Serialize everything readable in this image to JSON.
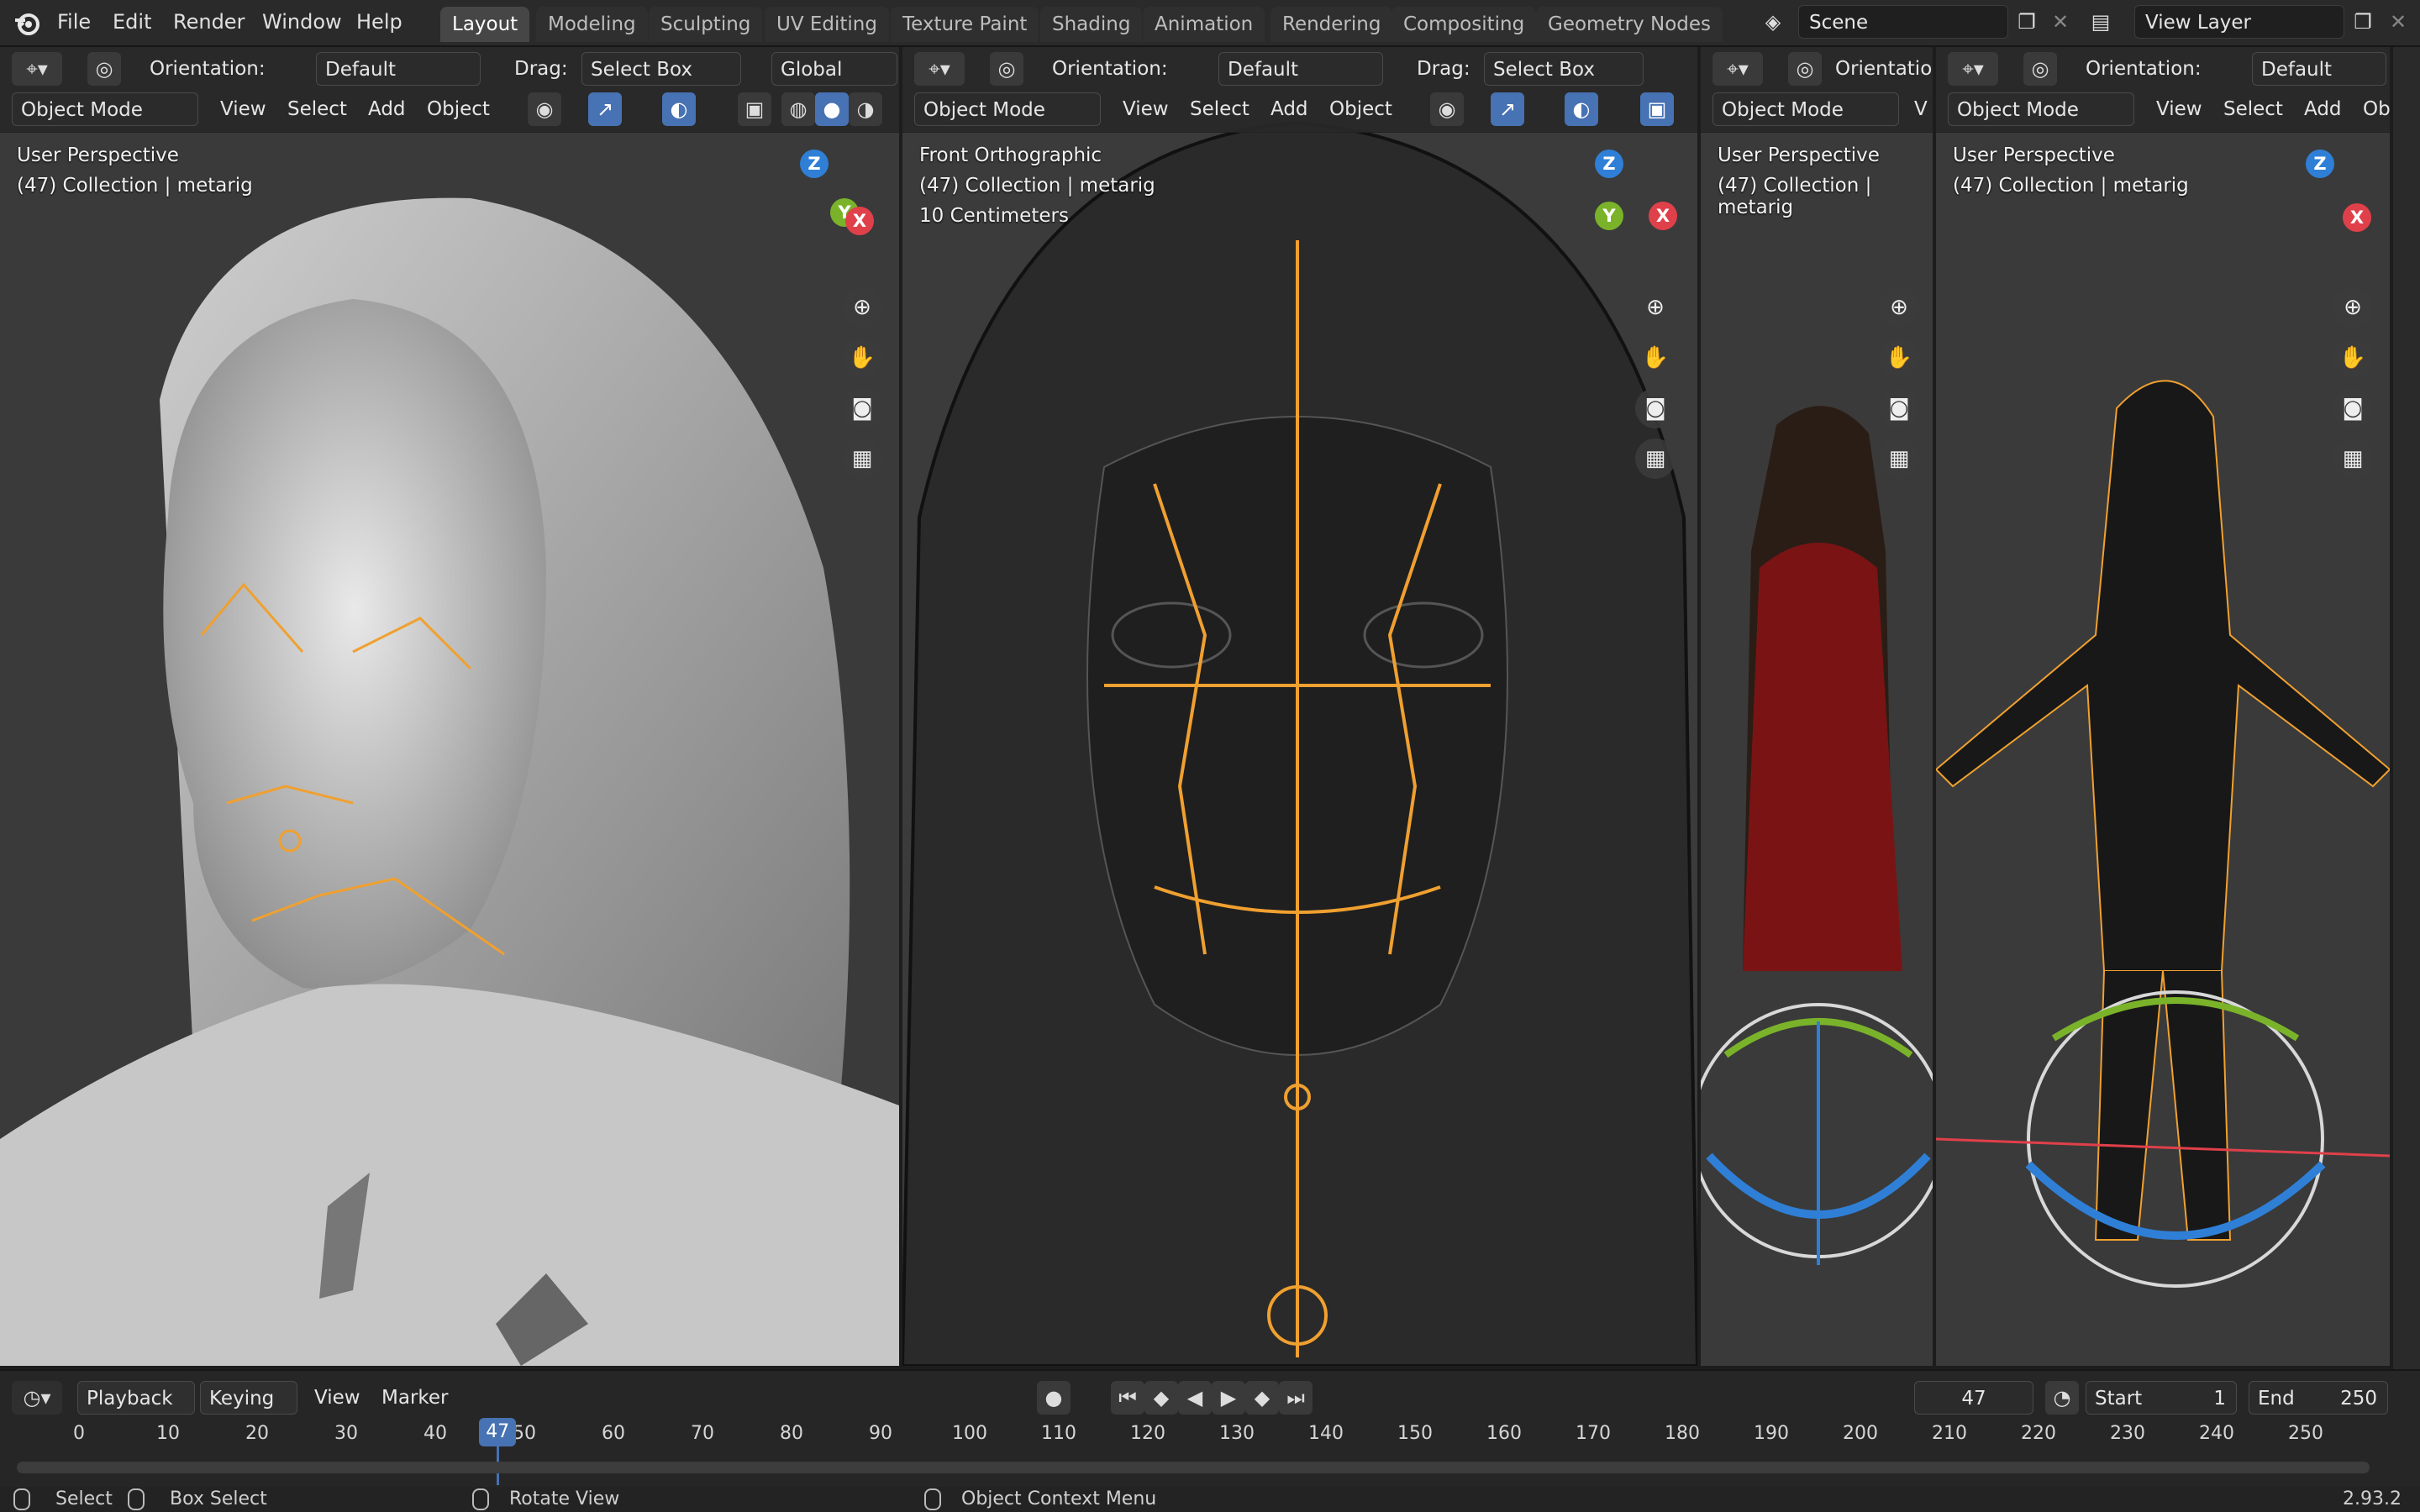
{
  "menu": [
    "File",
    "Edit",
    "Render",
    "Window",
    "Help"
  ],
  "workspaces": [
    "Layout",
    "Modeling",
    "Sculpting",
    "UV Editing",
    "Texture Paint",
    "Shading",
    "Animation",
    "Rendering",
    "Compositing",
    "Geometry Nodes"
  ],
  "scene": {
    "name": "Scene",
    "view_layer": "View Layer"
  },
  "viewports": [
    {
      "orientation_label": "Orientation:",
      "orientation": "Default",
      "drag_label": "Drag:",
      "drag": "Select Box",
      "transform": "Global",
      "mode": "Object Mode",
      "menus": [
        "View",
        "Select",
        "Add",
        "Object"
      ],
      "view_name": "User Perspective",
      "collection": "(47) Collection | metarig",
      "scale": ""
    },
    {
      "orientation_label": "Orientation:",
      "orientation": "Default",
      "drag_label": "Drag:",
      "drag": "Select Box",
      "mode": "Object Mode",
      "menus": [
        "View",
        "Select",
        "Add",
        "Object"
      ],
      "view_name": "Front Orthographic",
      "collection": "(47) Collection | metarig",
      "scale": "10 Centimeters"
    },
    {
      "orientation_label": "Orientation:",
      "mode": "Object Mode",
      "menus": [
        "V"
      ],
      "view_name": "User Perspective",
      "collection": "(47) Collection | metarig"
    },
    {
      "orientation_label": "Orientation:",
      "orientation": "Default",
      "mode": "Object Mode",
      "menus": [
        "View",
        "Select",
        "Add",
        "Ob"
      ],
      "view_name": "User Perspective",
      "collection": "(47) Collection | metarig"
    }
  ],
  "gizmo": {
    "z": "Z",
    "y": "Y",
    "x": "X"
  },
  "timeline": {
    "menus": [
      "Playback",
      "Keying",
      "View",
      "Marker"
    ],
    "current_frame": "47",
    "start_label": "Start",
    "start": "1",
    "end_label": "End",
    "end": "250",
    "ticks": [
      "0",
      "10",
      "20",
      "30",
      "40",
      "50",
      "60",
      "70",
      "80",
      "90",
      "100",
      "110",
      "120",
      "130",
      "140",
      "150",
      "160",
      "170",
      "180",
      "190",
      "200",
      "210",
      "220",
      "230",
      "240",
      "250"
    ]
  },
  "status": {
    "select": "Select",
    "box_select": "Box Select",
    "rotate": "Rotate View",
    "context": "Object Context Menu",
    "version": "2.93.2"
  },
  "colors": {
    "accent": "#4772b3",
    "bone": "#f0a030",
    "axis_x": "#e0404a",
    "axis_y": "#7ab32a",
    "axis_z": "#2f7fd6"
  },
  "icons": [
    "blender-logo-icon",
    "zoom-icon",
    "hand-icon",
    "camera-icon",
    "grid-icon",
    "play-icon"
  ]
}
